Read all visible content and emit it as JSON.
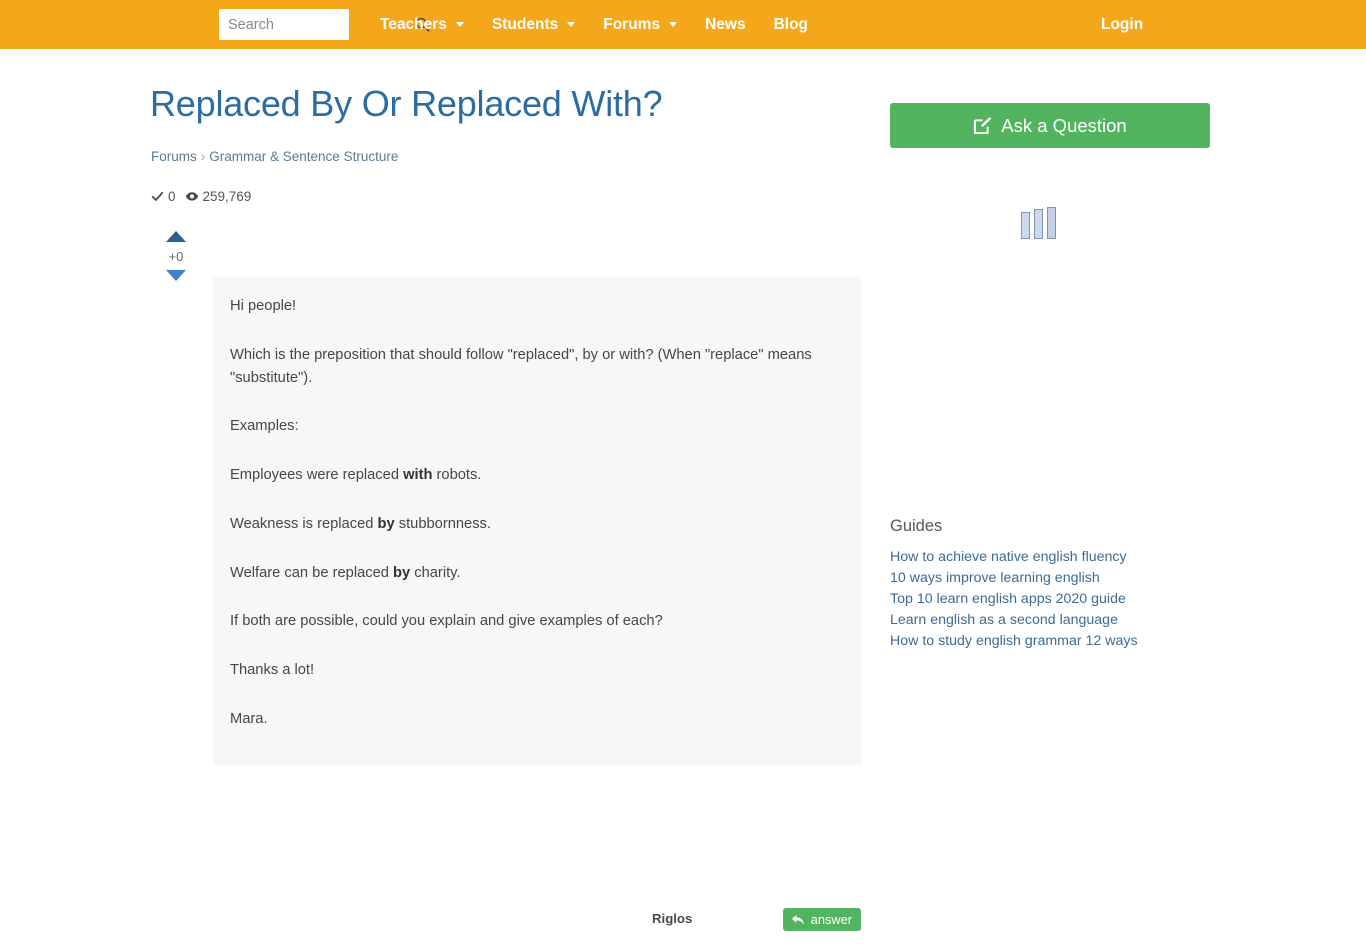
{
  "header": {
    "search": {
      "placeholder": "Search",
      "value": "",
      "icon": "search-icon"
    },
    "nav": [
      {
        "label": "Teachers",
        "has_dropdown": true
      },
      {
        "label": "Students",
        "has_dropdown": true
      },
      {
        "label": "Forums",
        "has_dropdown": true
      },
      {
        "label": "News",
        "has_dropdown": false
      },
      {
        "label": "Blog",
        "has_dropdown": false
      }
    ],
    "login_label": "Login",
    "background_color": "#f5a71c"
  },
  "question": {
    "title": "Replaced By Or Replaced With?",
    "title_color": "#2b6ca3",
    "breadcrumb": {
      "root": "Forums",
      "separator": "›",
      "category": "Grammar & Sentence Structure"
    },
    "stats": {
      "answers_icon": "check-icon",
      "answers_count": "0",
      "views_icon": "eye-icon",
      "views_count": "259,769"
    },
    "vote": {
      "up_icon": "arrow-up-icon",
      "down_icon": "arrow-down-icon",
      "score": "+0"
    },
    "body_paragraphs": [
      {
        "html": "Hi people!"
      },
      {
        "html": "Which is the preposition that should follow \"replaced\", by or with? (When \"replace\" means \"substitute\")."
      },
      {
        "html": "Examples:"
      },
      {
        "html": "Employees were replaced <b>with</b> robots."
      },
      {
        "html": "Weakness is replaced <b>by</b> stubbornness."
      },
      {
        "html": "Welfare can be replaced <b>by</b> charity."
      },
      {
        "html": "If both are possible, could you explain and give examples of each?"
      },
      {
        "html": "Thanks a lot!"
      },
      {
        "html": "Mara."
      }
    ],
    "author": "Riglos",
    "answer_button": {
      "label": "answer",
      "icon": "reply-arrow-icon",
      "color": "#52b45e"
    }
  },
  "sidebar": {
    "ask_button": {
      "label": "Ask a Question",
      "icon": "pencil-square-icon",
      "color": "#52b45e"
    },
    "loader": {
      "icon": "loading-bars-icon",
      "bars": 3
    },
    "guides_title": "Guides",
    "guides": [
      "How to achieve native english fluency",
      "10 ways improve learning english",
      "Top 10 learn english apps 2020 guide",
      "Learn english as a second language",
      "How to study english grammar 12 ways"
    ]
  }
}
